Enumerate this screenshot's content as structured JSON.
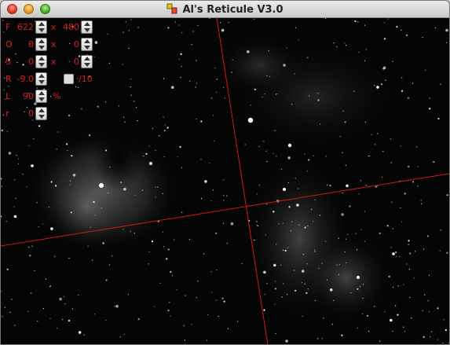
{
  "window": {
    "title": "Al's Reticule V3.0",
    "controls": [
      "close",
      "minimize",
      "zoom"
    ]
  },
  "panel": {
    "f": {
      "label": "F",
      "value": "622",
      "x_label": "x",
      "x_value": "480"
    },
    "o": {
      "label": "O",
      "value": "0",
      "x_label": "x",
      "x_value": "0"
    },
    "s": {
      "label": "S",
      "value": "0",
      "x_label": "x",
      "x_value": "0"
    },
    "r": {
      "label": "R",
      "value": "-9.0",
      "div_label": "/10"
    },
    "l": {
      "label": "L",
      "value": "90",
      "unit": "%"
    },
    "r2": {
      "label": "r",
      "value": "0"
    }
  },
  "reticle": {
    "color": "#d21818"
  },
  "icons": {
    "app": "app-icon",
    "steppers": "stepper-icon"
  }
}
